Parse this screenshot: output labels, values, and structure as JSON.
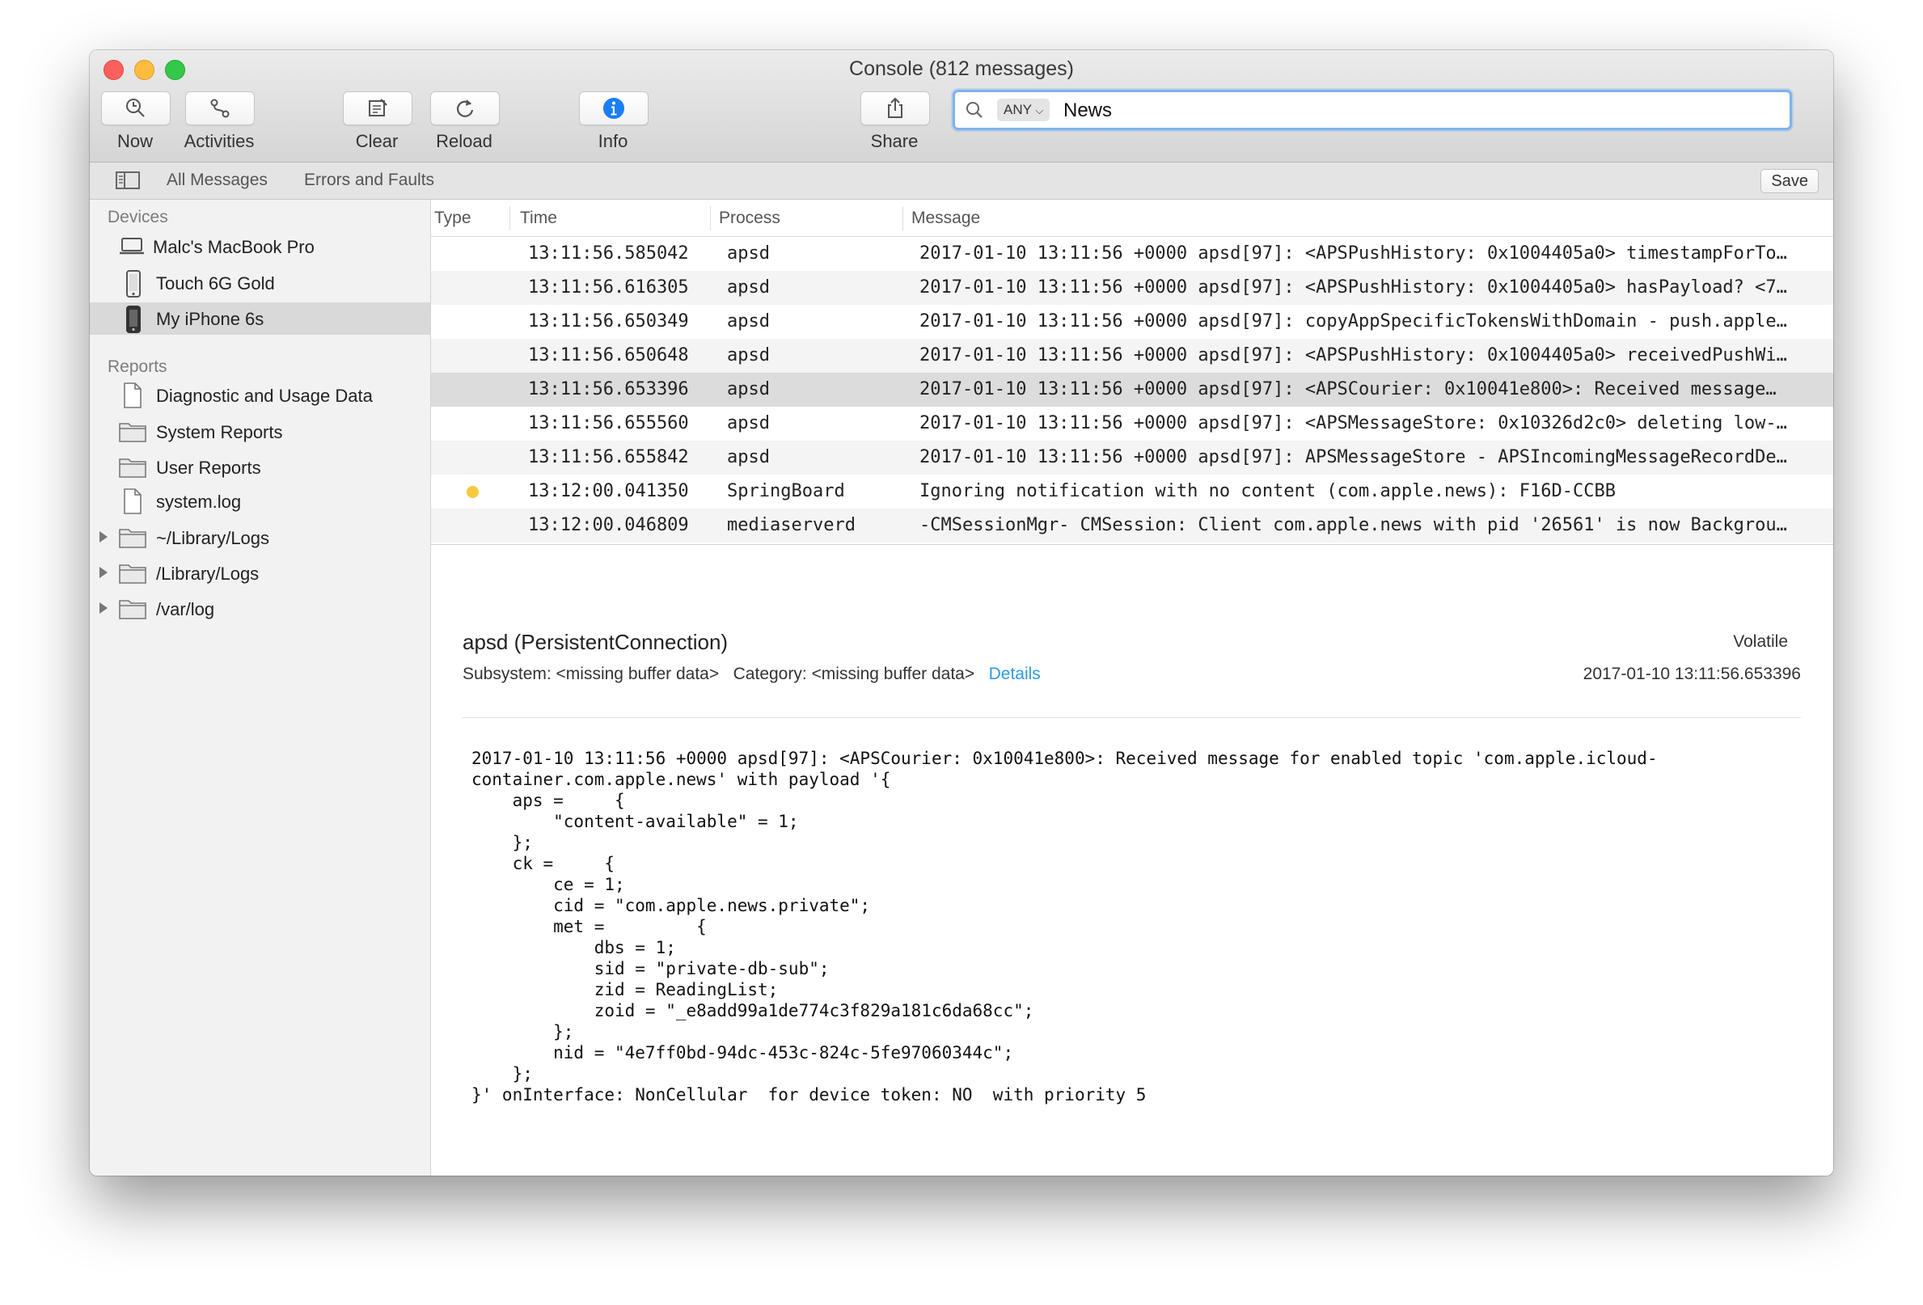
{
  "window": {
    "title": "Console (812 messages)"
  },
  "toolbar": {
    "buttons": [
      {
        "label": "Now",
        "icon": "now-icon"
      },
      {
        "label": "Activities",
        "icon": "activities-icon"
      },
      {
        "label": "Clear",
        "icon": "clear-icon"
      },
      {
        "label": "Reload",
        "icon": "reload-icon"
      },
      {
        "label": "Info",
        "icon": "info-icon"
      },
      {
        "label": "Share",
        "icon": "share-icon"
      }
    ],
    "search": {
      "scope": "ANY",
      "query": "News"
    }
  },
  "filterbar": {
    "items": [
      "All Messages",
      "Errors and Faults"
    ],
    "save_label": "Save"
  },
  "sidebar": {
    "devices_header": "Devices",
    "devices": [
      {
        "label": "Malc's MacBook Pro",
        "icon": "laptop-icon"
      },
      {
        "label": "Touch 6G Gold",
        "icon": "phone-icon"
      },
      {
        "label": "My iPhone 6s",
        "icon": "phone-icon",
        "selected": true
      }
    ],
    "reports_header": "Reports",
    "reports": [
      {
        "label": "Diagnostic and Usage Data",
        "icon": "document-icon"
      },
      {
        "label": "System Reports",
        "icon": "folder-icon"
      },
      {
        "label": "User Reports",
        "icon": "folder-icon"
      },
      {
        "label": "system.log",
        "icon": "document-icon"
      },
      {
        "label": "~/Library/Logs",
        "icon": "folder-icon",
        "expandable": true
      },
      {
        "label": "/Library/Logs",
        "icon": "folder-icon",
        "expandable": true
      },
      {
        "label": "/var/log",
        "icon": "folder-icon",
        "expandable": true
      }
    ]
  },
  "log": {
    "columns": [
      "Type",
      "Time",
      "Process",
      "Message"
    ],
    "rows": [
      {
        "time": "13:11:56.585042",
        "process": "apsd",
        "message": "2017-01-10 13:11:56 +0000 apsd[97]: <APSPushHistory: 0x1004405a0> timestampForTo…"
      },
      {
        "time": "13:11:56.616305",
        "process": "apsd",
        "message": "2017-01-10 13:11:56 +0000 apsd[97]: <APSPushHistory: 0x1004405a0> hasPayload? <7…"
      },
      {
        "time": "13:11:56.650349",
        "process": "apsd",
        "message": "2017-01-10 13:11:56 +0000 apsd[97]: copyAppSpecificTokensWithDomain - push.apple…"
      },
      {
        "time": "13:11:56.650648",
        "process": "apsd",
        "message": "2017-01-10 13:11:56 +0000 apsd[97]: <APSPushHistory: 0x1004405a0> receivedPushWi…"
      },
      {
        "time": "13:11:56.653396",
        "process": "apsd",
        "message": "2017-01-10 13:11:56 +0000 apsd[97]: <APSCourier: 0x10041e800>: Received message…",
        "selected": true
      },
      {
        "time": "13:11:56.655560",
        "process": "apsd",
        "message": "2017-01-10 13:11:56 +0000 apsd[97]: <APSMessageStore: 0x10326d2c0> deleting low-…"
      },
      {
        "time": "13:11:56.655842",
        "process": "apsd",
        "message": "2017-01-10 13:11:56 +0000 apsd[97]: APSMessageStore - APSIncomingMessageRecordDe…"
      },
      {
        "time": "13:12:00.041350",
        "process": "SpringBoard",
        "message": "Ignoring notification with no content (com.apple.news): F16D-CCBB",
        "type_dot": true
      },
      {
        "time": "13:12:00.046809",
        "process": "mediaserverd",
        "message": "-CMSessionMgr- CMSession: Client com.apple.news with pid '26561' is now Backgrou…"
      }
    ]
  },
  "detail": {
    "title": "apsd (PersistentConnection)",
    "volatile": "Volatile",
    "subsystem": "Subsystem: <missing buffer data>",
    "category": "Category: <missing buffer data>",
    "details_link": "Details",
    "date": "2017-01-10 13:11:56.653396",
    "body": "2017-01-10 13:11:56 +0000 apsd[97]: <APSCourier: 0x10041e800>: Received message for enabled topic 'com.apple.icloud-\ncontainer.com.apple.news' with payload '{\n    aps =     {\n        \"content-available\" = 1;\n    };\n    ck =     {\n        ce = 1;\n        cid = \"com.apple.news.private\";\n        met =         {\n            dbs = 1;\n            sid = \"private-db-sub\";\n            zid = ReadingList;\n            zoid = \"_e8add99a1de774c3f829a181c6da68cc\";\n        };\n        nid = \"4e7ff0bd-94dc-453c-824c-5fe97060344c\";\n    };\n}' onInterface: NonCellular  for device token: NO  with priority 5"
  }
}
